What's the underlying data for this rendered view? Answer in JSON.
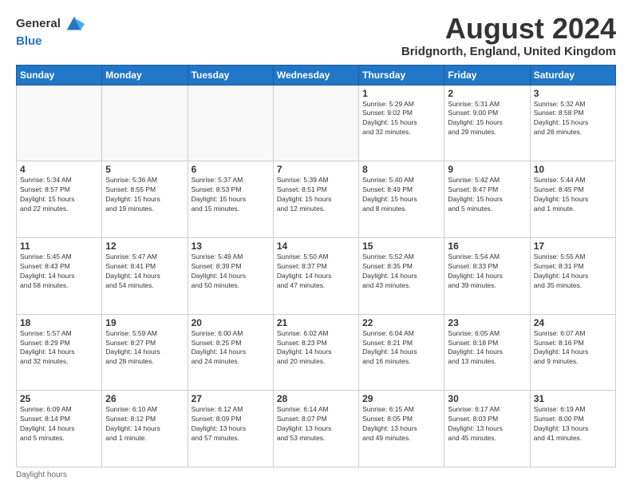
{
  "header": {
    "logo_line1": "General",
    "logo_line2": "Blue",
    "month_title": "August 2024",
    "location": "Bridgnorth, England, United Kingdom"
  },
  "days_of_week": [
    "Sunday",
    "Monday",
    "Tuesday",
    "Wednesday",
    "Thursday",
    "Friday",
    "Saturday"
  ],
  "weeks": [
    [
      {
        "day": "",
        "info": ""
      },
      {
        "day": "",
        "info": ""
      },
      {
        "day": "",
        "info": ""
      },
      {
        "day": "",
        "info": ""
      },
      {
        "day": "1",
        "info": "Sunrise: 5:29 AM\nSunset: 9:02 PM\nDaylight: 15 hours\nand 32 minutes."
      },
      {
        "day": "2",
        "info": "Sunrise: 5:31 AM\nSunset: 9:00 PM\nDaylight: 15 hours\nand 29 minutes."
      },
      {
        "day": "3",
        "info": "Sunrise: 5:32 AM\nSunset: 8:58 PM\nDaylight: 15 hours\nand 26 minutes."
      }
    ],
    [
      {
        "day": "4",
        "info": "Sunrise: 5:34 AM\nSunset: 8:57 PM\nDaylight: 15 hours\nand 22 minutes."
      },
      {
        "day": "5",
        "info": "Sunrise: 5:36 AM\nSunset: 8:55 PM\nDaylight: 15 hours\nand 19 minutes."
      },
      {
        "day": "6",
        "info": "Sunrise: 5:37 AM\nSunset: 8:53 PM\nDaylight: 15 hours\nand 15 minutes."
      },
      {
        "day": "7",
        "info": "Sunrise: 5:39 AM\nSunset: 8:51 PM\nDaylight: 15 hours\nand 12 minutes."
      },
      {
        "day": "8",
        "info": "Sunrise: 5:40 AM\nSunset: 8:49 PM\nDaylight: 15 hours\nand 8 minutes."
      },
      {
        "day": "9",
        "info": "Sunrise: 5:42 AM\nSunset: 8:47 PM\nDaylight: 15 hours\nand 5 minutes."
      },
      {
        "day": "10",
        "info": "Sunrise: 5:44 AM\nSunset: 8:45 PM\nDaylight: 15 hours\nand 1 minute."
      }
    ],
    [
      {
        "day": "11",
        "info": "Sunrise: 5:45 AM\nSunset: 8:43 PM\nDaylight: 14 hours\nand 58 minutes."
      },
      {
        "day": "12",
        "info": "Sunrise: 5:47 AM\nSunset: 8:41 PM\nDaylight: 14 hours\nand 54 minutes."
      },
      {
        "day": "13",
        "info": "Sunrise: 5:49 AM\nSunset: 8:39 PM\nDaylight: 14 hours\nand 50 minutes."
      },
      {
        "day": "14",
        "info": "Sunrise: 5:50 AM\nSunset: 8:37 PM\nDaylight: 14 hours\nand 47 minutes."
      },
      {
        "day": "15",
        "info": "Sunrise: 5:52 AM\nSunset: 8:35 PM\nDaylight: 14 hours\nand 43 minutes."
      },
      {
        "day": "16",
        "info": "Sunrise: 5:54 AM\nSunset: 8:33 PM\nDaylight: 14 hours\nand 39 minutes."
      },
      {
        "day": "17",
        "info": "Sunrise: 5:55 AM\nSunset: 8:31 PM\nDaylight: 14 hours\nand 35 minutes."
      }
    ],
    [
      {
        "day": "18",
        "info": "Sunrise: 5:57 AM\nSunset: 8:29 PM\nDaylight: 14 hours\nand 32 minutes."
      },
      {
        "day": "19",
        "info": "Sunrise: 5:59 AM\nSunset: 8:27 PM\nDaylight: 14 hours\nand 28 minutes."
      },
      {
        "day": "20",
        "info": "Sunrise: 6:00 AM\nSunset: 8:25 PM\nDaylight: 14 hours\nand 24 minutes."
      },
      {
        "day": "21",
        "info": "Sunrise: 6:02 AM\nSunset: 8:23 PM\nDaylight: 14 hours\nand 20 minutes."
      },
      {
        "day": "22",
        "info": "Sunrise: 6:04 AM\nSunset: 8:21 PM\nDaylight: 14 hours\nand 16 minutes."
      },
      {
        "day": "23",
        "info": "Sunrise: 6:05 AM\nSunset: 8:18 PM\nDaylight: 14 hours\nand 13 minutes."
      },
      {
        "day": "24",
        "info": "Sunrise: 6:07 AM\nSunset: 8:16 PM\nDaylight: 14 hours\nand 9 minutes."
      }
    ],
    [
      {
        "day": "25",
        "info": "Sunrise: 6:09 AM\nSunset: 8:14 PM\nDaylight: 14 hours\nand 5 minutes."
      },
      {
        "day": "26",
        "info": "Sunrise: 6:10 AM\nSunset: 8:12 PM\nDaylight: 14 hours\nand 1 minute."
      },
      {
        "day": "27",
        "info": "Sunrise: 6:12 AM\nSunset: 8:09 PM\nDaylight: 13 hours\nand 57 minutes."
      },
      {
        "day": "28",
        "info": "Sunrise: 6:14 AM\nSunset: 8:07 PM\nDaylight: 13 hours\nand 53 minutes."
      },
      {
        "day": "29",
        "info": "Sunrise: 6:15 AM\nSunset: 8:05 PM\nDaylight: 13 hours\nand 49 minutes."
      },
      {
        "day": "30",
        "info": "Sunrise: 6:17 AM\nSunset: 8:03 PM\nDaylight: 13 hours\nand 45 minutes."
      },
      {
        "day": "31",
        "info": "Sunrise: 6:19 AM\nSunset: 8:00 PM\nDaylight: 13 hours\nand 41 minutes."
      }
    ]
  ],
  "footer": {
    "note": "Daylight hours"
  }
}
